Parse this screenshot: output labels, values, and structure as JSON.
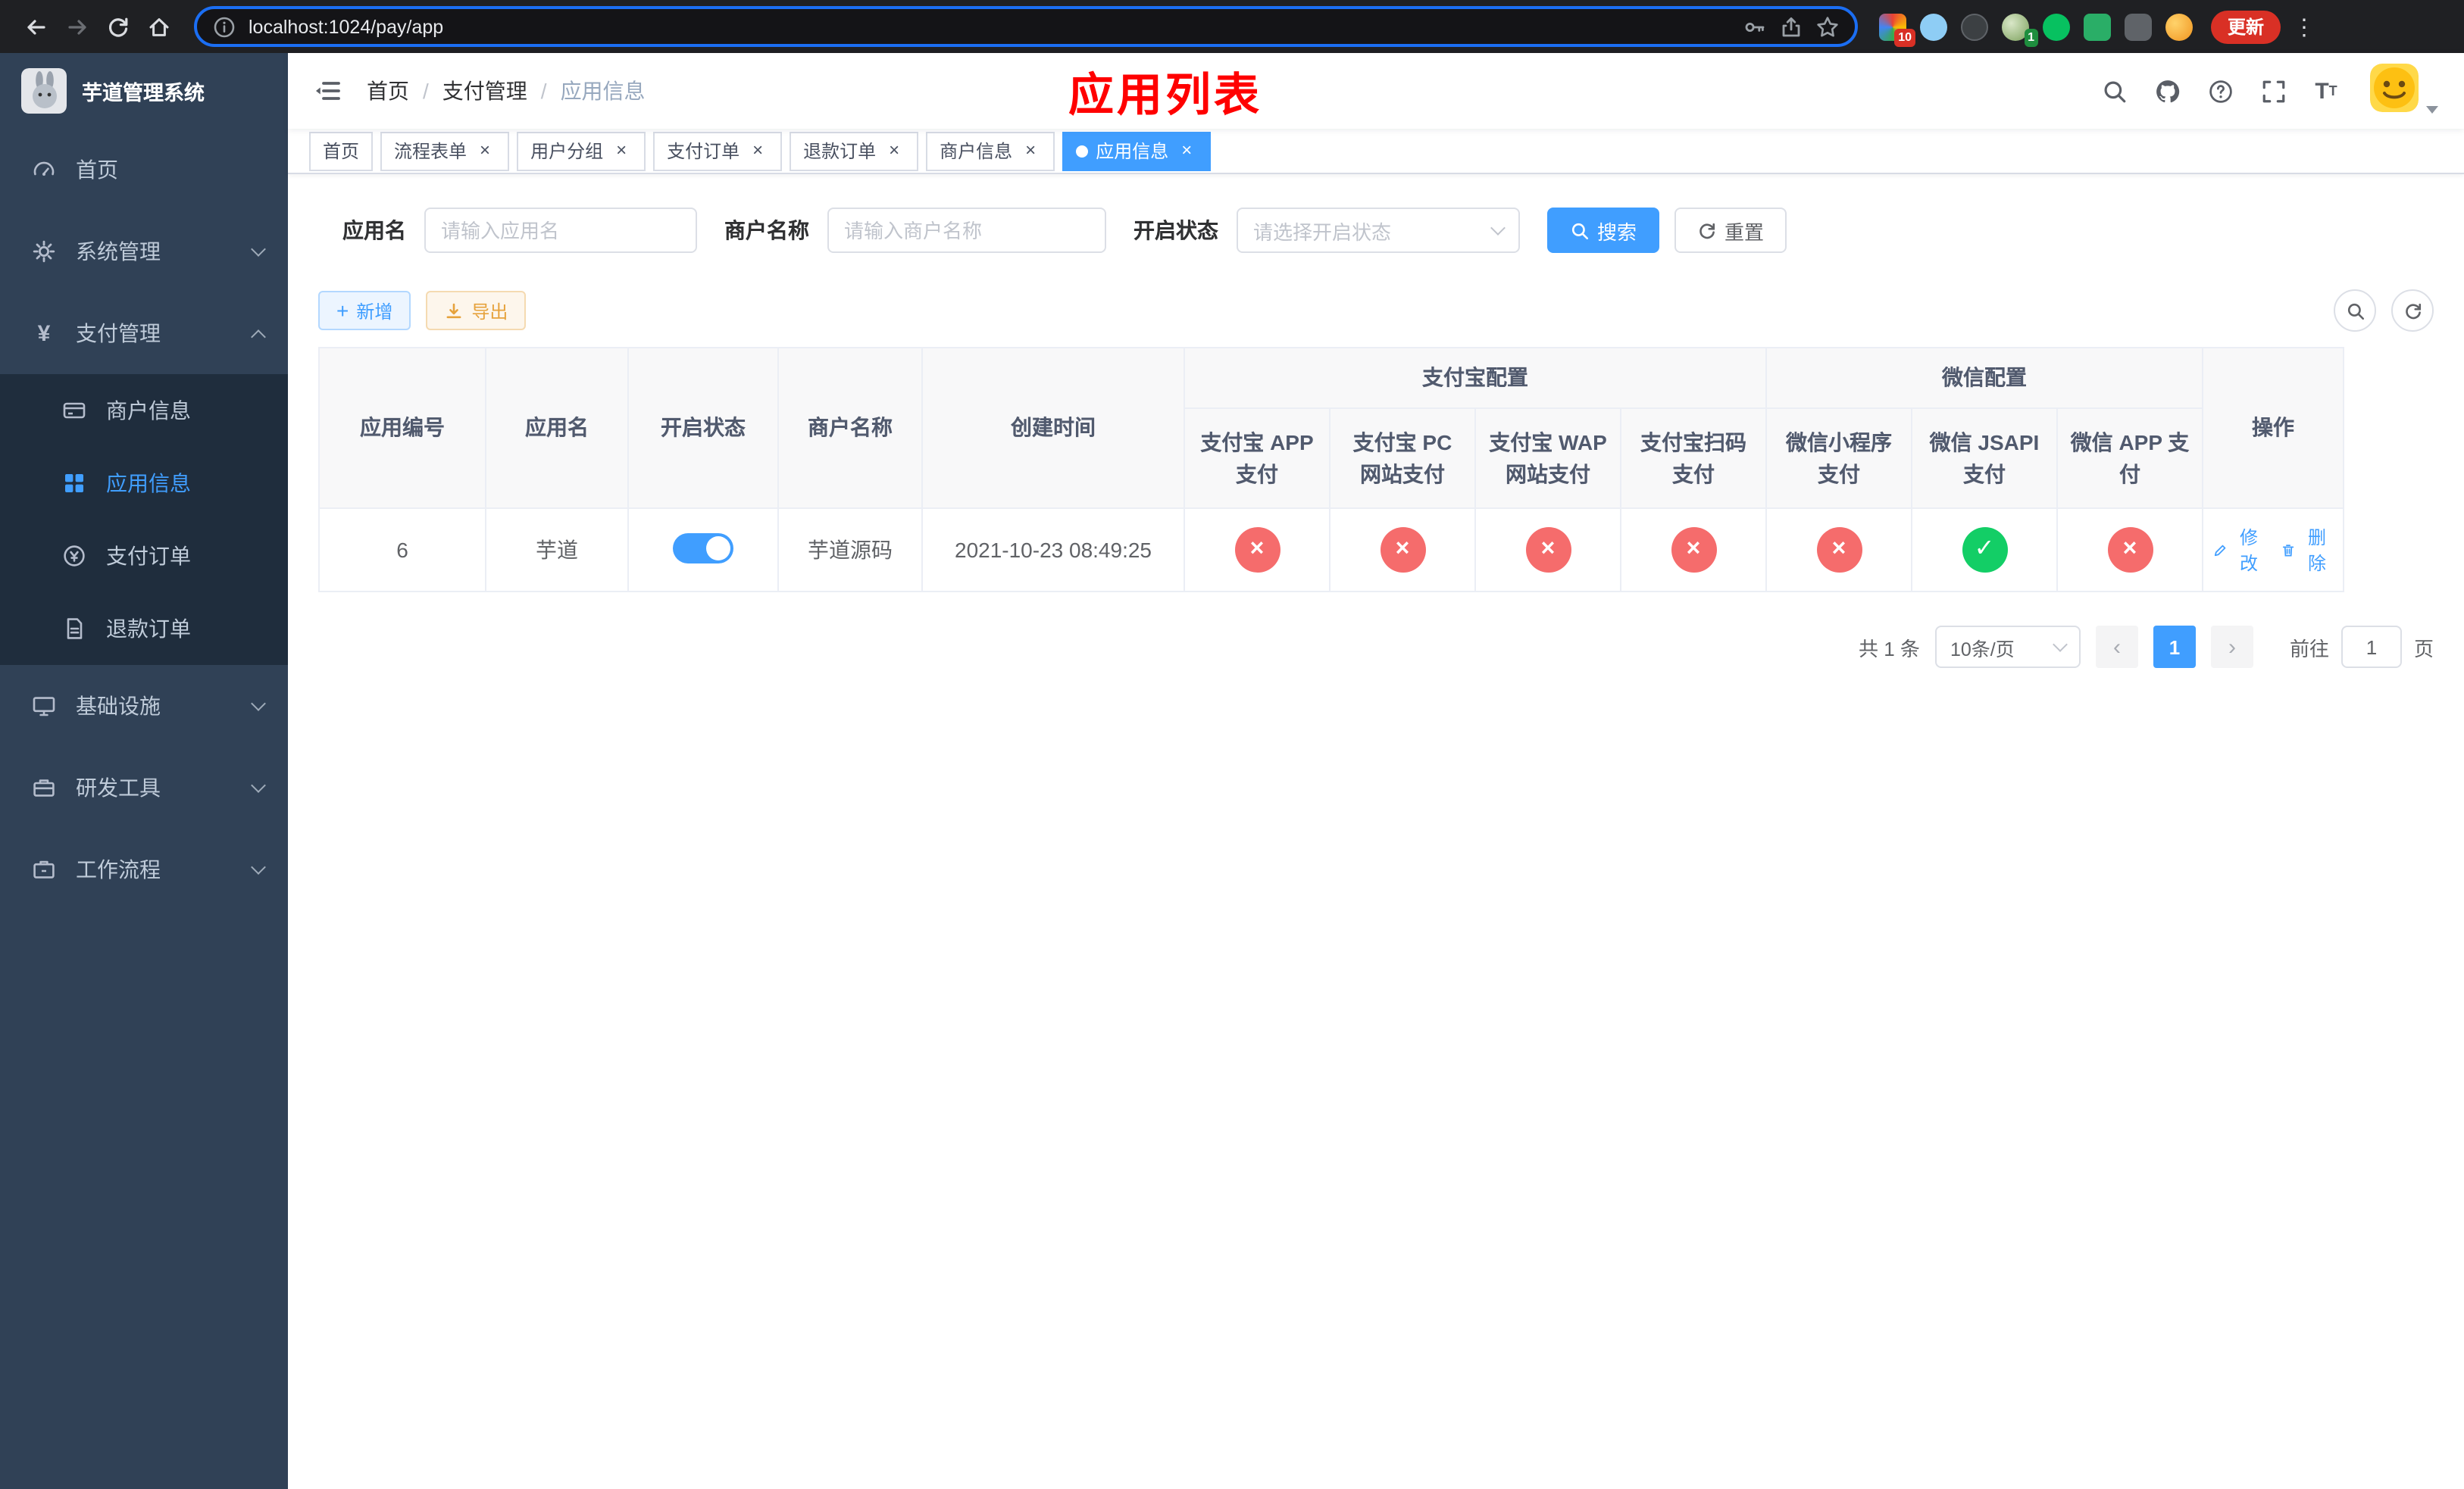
{
  "browser": {
    "url": "localhost:1024/pay/app",
    "update_button": "更新",
    "ext_badge_1": "10",
    "ext_badge_2": "1"
  },
  "sidebar": {
    "app_title": "芋道管理系统",
    "items": [
      {
        "label": "首页"
      },
      {
        "label": "系统管理"
      },
      {
        "label": "支付管理"
      },
      {
        "label": "基础设施"
      },
      {
        "label": "研发工具"
      },
      {
        "label": "工作流程"
      }
    ],
    "pay_sub_items": [
      {
        "label": "商户信息"
      },
      {
        "label": "应用信息"
      },
      {
        "label": "支付订单"
      },
      {
        "label": "退款订单"
      }
    ]
  },
  "navbar": {
    "breadcrumb": [
      "首页",
      "支付管理",
      "应用信息"
    ],
    "page_title": "应用列表"
  },
  "tabs": [
    {
      "label": "首页"
    },
    {
      "label": "流程表单"
    },
    {
      "label": "用户分组"
    },
    {
      "label": "支付订单"
    },
    {
      "label": "退款订单"
    },
    {
      "label": "商户信息"
    },
    {
      "label": "应用信息"
    }
  ],
  "filters": {
    "app_name_label": "应用名",
    "app_name_placeholder": "请输入应用名",
    "merchant_label": "商户名称",
    "merchant_placeholder": "请输入商户名称",
    "status_label": "开启状态",
    "status_placeholder": "请选择开启状态",
    "search_button": "搜索",
    "reset_button": "重置"
  },
  "toolbar": {
    "add_button": "新增",
    "export_button": "导出"
  },
  "table": {
    "headers": {
      "app_id": "应用编号",
      "app_name": "应用名",
      "status": "开启状态",
      "merchant": "商户名称",
      "created": "创建时间",
      "alipay_group": "支付宝配置",
      "wechat_group": "微信配置",
      "alipay_app": "支付宝 APP 支付",
      "alipay_pc": "支付宝 PC 网站支付",
      "alipay_wap": "支付宝 WAP 网站支付",
      "alipay_qr": "支付宝扫码支付",
      "wx_mini": "微信小程序支付",
      "wx_jsapi": "微信 JSAPI 支付",
      "wx_app": "微信 APP 支付",
      "actions": "操作"
    },
    "rows": [
      {
        "app_id": "6",
        "app_name": "芋道",
        "status_on": true,
        "merchant": "芋道源码",
        "created": "2021-10-23 08:49:25",
        "alipay_app": "fail",
        "alipay_pc": "fail",
        "alipay_wap": "fail",
        "alipay_qr": "fail",
        "wx_mini": "fail",
        "wx_jsapi": "ok",
        "wx_app": "fail",
        "edit": "修改",
        "delete": "删除"
      }
    ]
  },
  "pagination": {
    "total": "共 1 条",
    "page_size": "10条/页",
    "current_page": "1",
    "goto_label": "前往",
    "goto_value": "1",
    "page_label": "页"
  },
  "colors": {
    "primary": "#409eff",
    "success": "#13ce66",
    "danger": "#f56c6c",
    "warning": "#e6a23c",
    "sidebar_bg": "#304156",
    "sidebar_sub_bg": "#1f2d3d",
    "title_red": "#ff0000"
  }
}
